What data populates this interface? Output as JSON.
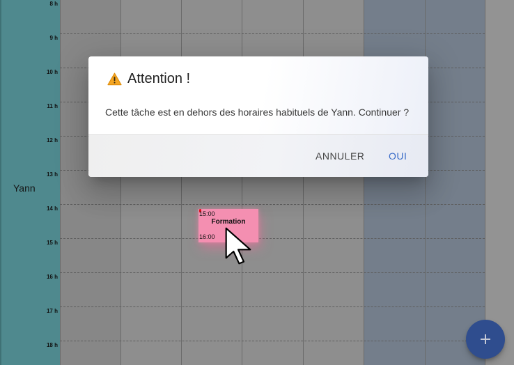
{
  "calendar": {
    "resource_name": "Yann",
    "hours": [
      "8 h",
      "9 h",
      "10 h",
      "11 h",
      "12 h",
      "13 h",
      "14 h",
      "15 h",
      "16 h",
      "17 h",
      "18 h"
    ],
    "colors": {
      "resource": "#4f898e",
      "weekday": "#8e8e8e",
      "weekend": "#747e8b"
    }
  },
  "event": {
    "title": "Formation",
    "start": "15:00",
    "end": "16:00",
    "color": "#f48fb1"
  },
  "dialog": {
    "icon": "warning-icon",
    "title": "Attention !",
    "message": "Cette tâche est en dehors des horaires habituels de Yann. Continuer ?",
    "cancel_label": "ANNULER",
    "confirm_label": "OUI",
    "confirm_color": "#3a6cc8"
  },
  "fab": {
    "icon": "plus-icon",
    "color": "#2f4d8e"
  },
  "cursor": {
    "icon": "mouse-pointer-icon"
  }
}
